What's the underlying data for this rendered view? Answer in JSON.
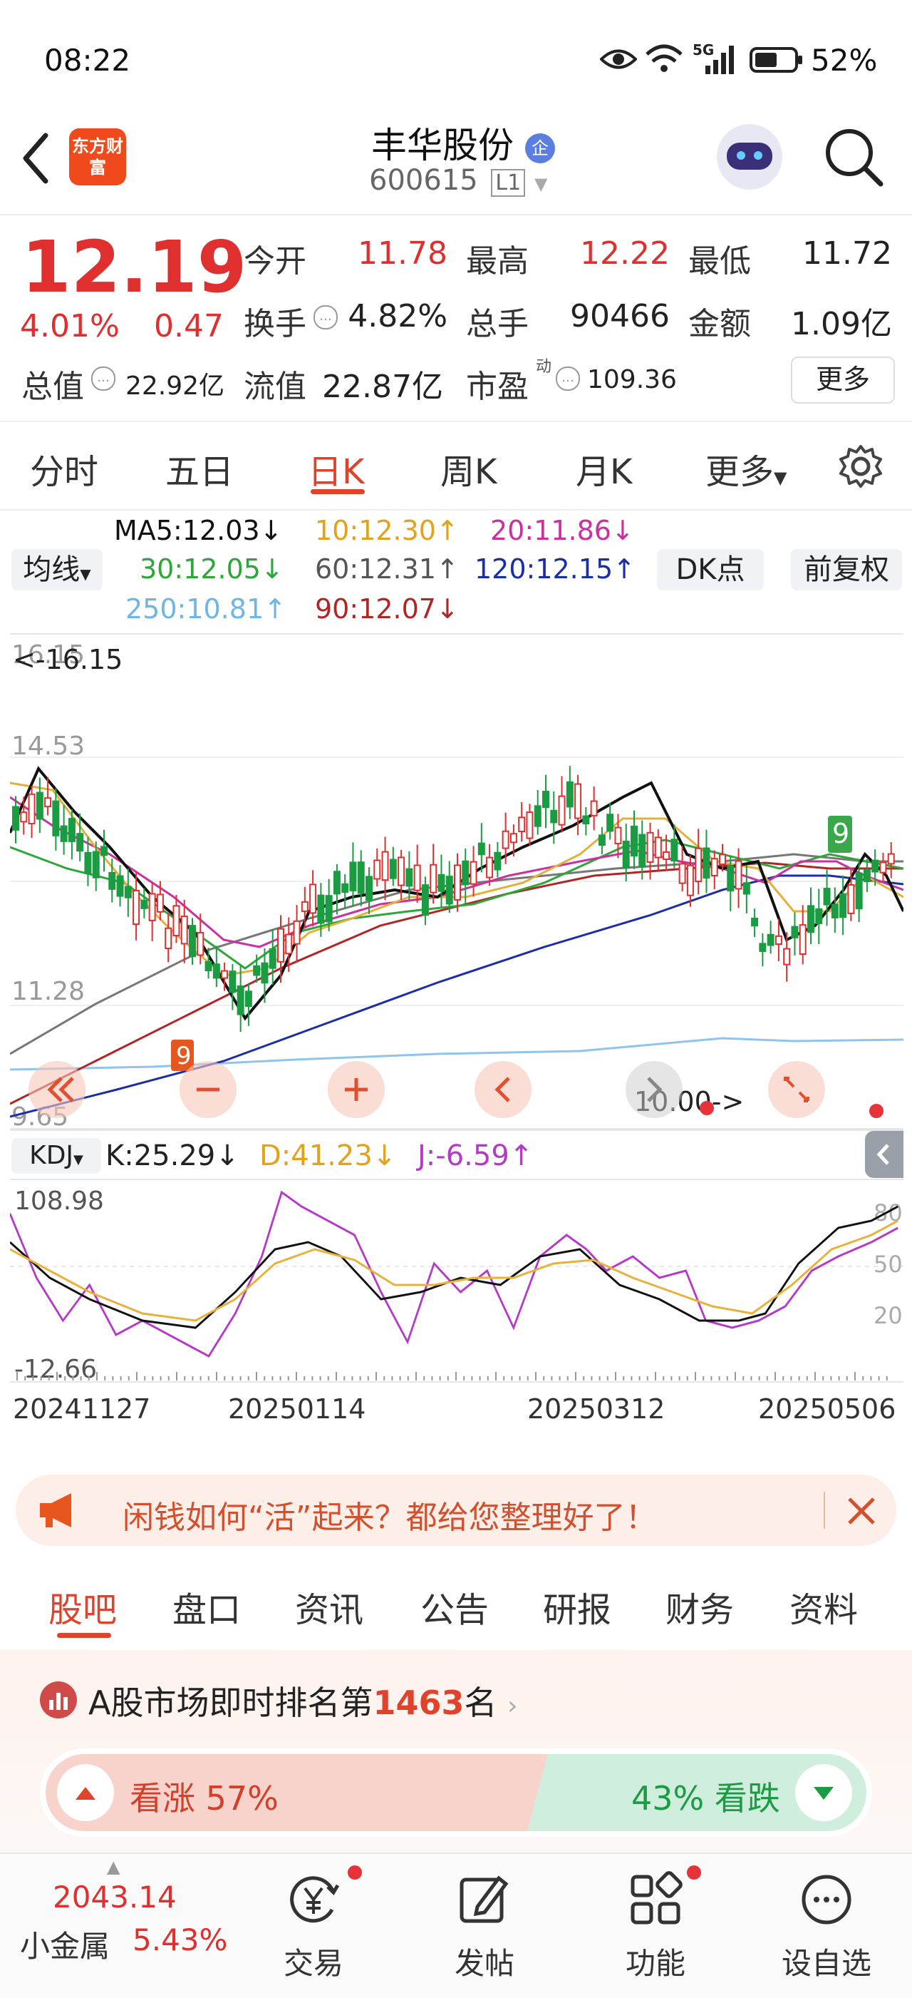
{
  "status_bar": {
    "time": "08:22",
    "battery": "52%",
    "network": "5G"
  },
  "header": {
    "logo_text": "东方财富",
    "stock_name": "丰华股份",
    "name_badge": "企",
    "code": "600615",
    "level": "L1"
  },
  "quote": {
    "price": "12.19",
    "change_pct": "4.01%",
    "change": "0.47",
    "open_label": "今开",
    "open": "11.78",
    "high_label": "最高",
    "high": "12.22",
    "low_label": "最低",
    "low": "11.72",
    "turnover_label": "换手",
    "turnover": "4.82%",
    "volume_label": "总手",
    "volume": "90466",
    "amount_label": "金额",
    "amount": "1.09亿",
    "mcap_label": "总值",
    "mcap": "22.92亿",
    "float_label": "流值",
    "float_mcap": "22.87亿",
    "pe_label": "市盈",
    "pe_sup": "动",
    "pe": "109.36",
    "more_label": "更多"
  },
  "period_tabs": [
    "分时",
    "五日",
    "日K",
    "周K",
    "月K",
    "更多"
  ],
  "period_active": "日K",
  "ma_legend": {
    "selector": "均线",
    "ma5": "MA5:12.03↓",
    "ma10": "10:12.30↑",
    "ma20": "20:11.86↓",
    "ma30": "30:12.05↓",
    "ma60": "60:12.31↑",
    "ma120": "120:12.15↑",
    "ma250": "250:10.81↑",
    "ma90": "90:12.07↓",
    "dk_label": "DK点",
    "fq_label": "前复权"
  },
  "colors": {
    "up": "#e02f2f",
    "down": "#1b9c43",
    "ma5": "#111111",
    "ma10": "#e8b23a",
    "ma20": "#cc2fa0",
    "ma30": "#2ea63a",
    "ma60": "#777777",
    "ma120": "#1a2ea8",
    "ma250": "#8fc4ec",
    "ma90": "#b02525"
  },
  "chart": {
    "y_labels": [
      "16.15",
      "14.53",
      "11.28",
      "9.65"
    ],
    "max_marker": "<-16.15",
    "min_marker": "10.00->",
    "nine_labels": [
      "9",
      "9"
    ],
    "controls": [
      "double-left-icon",
      "zoom-out-icon",
      "zoom-in-icon",
      "step-left-icon",
      "step-right-icon",
      "fullscreen-icon"
    ]
  },
  "kdj": {
    "selector": "KDJ",
    "k": "K:25.29↓",
    "d": "D:41.23↓",
    "j": "J:-6.59↑",
    "y_top": "108.98",
    "y_bottom": "-12.66",
    "levels": [
      "80",
      "50",
      "20"
    ]
  },
  "dates": [
    "20241127",
    "20250114",
    "20250312",
    "20250506"
  ],
  "banner": {
    "text": "闲钱如何“活”起来？都给您整理好了！"
  },
  "section_tabs": [
    "股吧",
    "盘口",
    "资讯",
    "公告",
    "研报",
    "财务",
    "资料"
  ],
  "section_active": "股吧",
  "ranking": {
    "prefix": "A股市场即时排名第",
    "rank": "1463",
    "suffix": "名",
    "bull_label": "看涨 57%",
    "bear_label": "43% 看跌",
    "bull_pct": 57
  },
  "bottom_bar": {
    "index_value": "2043.14",
    "index_name": "小金属",
    "index_pct": "5.43%",
    "items": [
      "交易",
      "发帖",
      "功能",
      "设自选"
    ]
  }
}
